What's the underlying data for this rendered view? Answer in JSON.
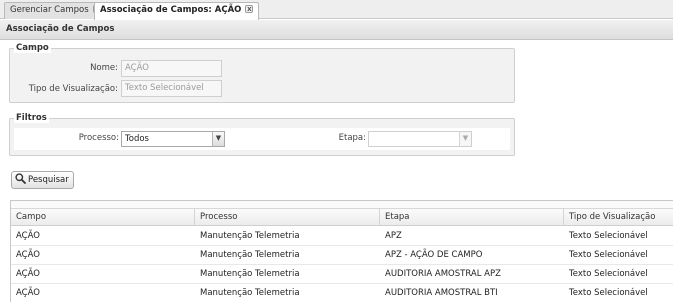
{
  "tabs": [
    {
      "label": "Gerenciar Campos",
      "close": "x"
    },
    {
      "label": "Associação de Campos: AÇÃO",
      "close": "x"
    }
  ],
  "panel": {
    "title": "Associação de Campos"
  },
  "campo": {
    "legend": "Campo",
    "nome_label": "Nome:",
    "nome_value": "AÇÃO",
    "tipo_label": "Tipo de Visualização:",
    "tipo_value": "Texto Selecionável"
  },
  "filtros": {
    "legend": "Filtros",
    "processo_label": "Processo:",
    "processo_value": "Todos",
    "etapa_label": "Etapa:",
    "etapa_value": ""
  },
  "search_button": {
    "label": "Pesquisar",
    "icon": "magnifier-icon"
  },
  "grid": {
    "columns": [
      "Campo",
      "Processo",
      "Etapa",
      "Tipo de Visualização"
    ],
    "rows": [
      [
        "AÇÃO",
        "Manutenção Telemetria",
        "APZ",
        "Texto Selecionável"
      ],
      [
        "AÇÃO",
        "Manutenção Telemetria",
        "APZ - AÇÃO DE CAMPO",
        "Texto Selecionável"
      ],
      [
        "AÇÃO",
        "Manutenção Telemetria",
        "AUDITORIA AMOSTRAL APZ",
        "Texto Selecionável"
      ],
      [
        "AÇÃO",
        "Manutenção Telemetria",
        "AUDITORIA AMOSTRAL BTI",
        "Texto Selecionável"
      ]
    ]
  }
}
